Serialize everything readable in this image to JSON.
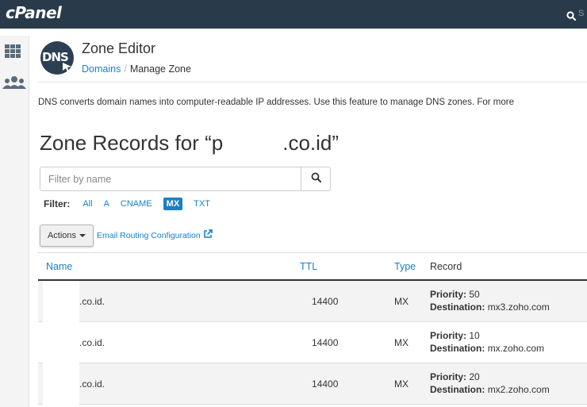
{
  "app": {
    "logo": "cPanel",
    "search_partial": "S"
  },
  "header": {
    "title": "Zone Editor",
    "icon_text": "DNS"
  },
  "breadcrumb": {
    "domains": "Domains",
    "separator": "/",
    "current": "Manage Zone"
  },
  "description": "DNS converts domain names into computer-readable IP addresses. Use this feature to manage DNS zones. For more",
  "zone": {
    "title_prefix": "Zone Records for “p",
    "title_suffix": ".co.id”"
  },
  "filter": {
    "placeholder": "Filter by name",
    "label": "Filter:",
    "options": [
      "All",
      "A",
      "CNAME",
      "MX",
      "TXT"
    ],
    "active": "MX"
  },
  "toolbar": {
    "actions_label": "Actions",
    "email_routing_label": "Email Routing Configuration"
  },
  "table": {
    "columns": {
      "name": "Name",
      "ttl": "TTL",
      "type": "Type",
      "record": "Record"
    },
    "rows": [
      {
        "name": ".co.id.",
        "ttl": "14400",
        "type": "MX",
        "priority_label": "Priority:",
        "priority": "50",
        "destination_label": "Destination:",
        "destination": "mx3.zoho.com"
      },
      {
        "name": ".co.id.",
        "ttl": "14400",
        "type": "MX",
        "priority_label": "Priority:",
        "priority": "10",
        "destination_label": "Destination:",
        "destination": "mx.zoho.com"
      },
      {
        "name": ".co.id.",
        "ttl": "14400",
        "type": "MX",
        "priority_label": "Priority:",
        "priority": "20",
        "destination_label": "Destination:",
        "destination": "mx2.zoho.com"
      }
    ]
  },
  "colors": {
    "topbar": "#293a4a",
    "link": "#1a7fc7",
    "active_filter": "#1a7fc7"
  }
}
